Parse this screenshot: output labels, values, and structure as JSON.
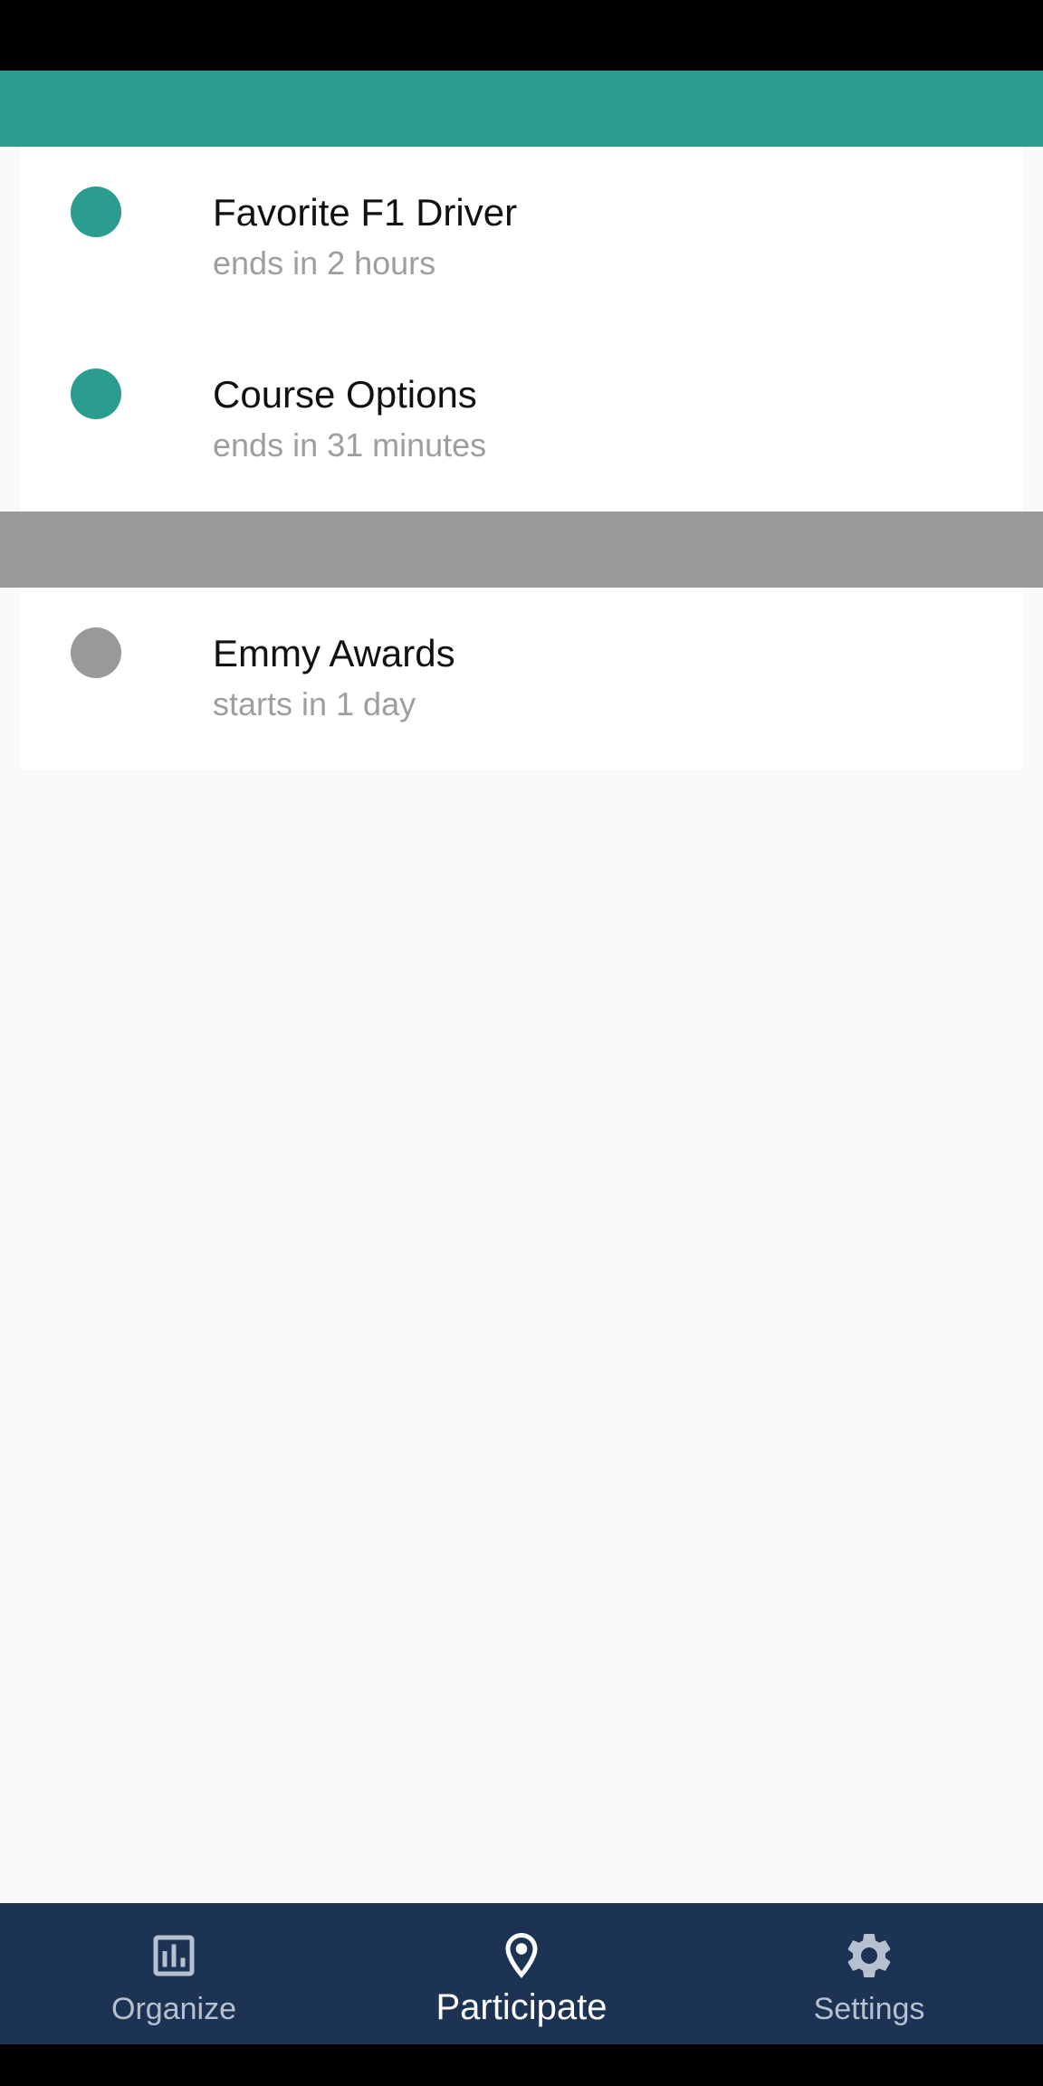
{
  "colors": {
    "accent": "#2a9d8f",
    "upcoming": "#999999",
    "nav_background": "#1d3354"
  },
  "active_polls": [
    {
      "title": "Favorite F1 Driver",
      "subtitle": "ends in 2 hours",
      "status": "active"
    },
    {
      "title": "Course Options",
      "subtitle": "ends in 31 minutes",
      "status": "active"
    }
  ],
  "upcoming_polls": [
    {
      "title": "Emmy Awards",
      "subtitle": "starts in 1 day",
      "status": "upcoming"
    }
  ],
  "bottom_nav": {
    "selected": "Participate",
    "items": [
      {
        "label": "Organize",
        "icon": "bar-chart-icon"
      },
      {
        "label": "Participate",
        "icon": "location-pin-icon"
      },
      {
        "label": "Settings",
        "icon": "gear-icon"
      }
    ]
  }
}
